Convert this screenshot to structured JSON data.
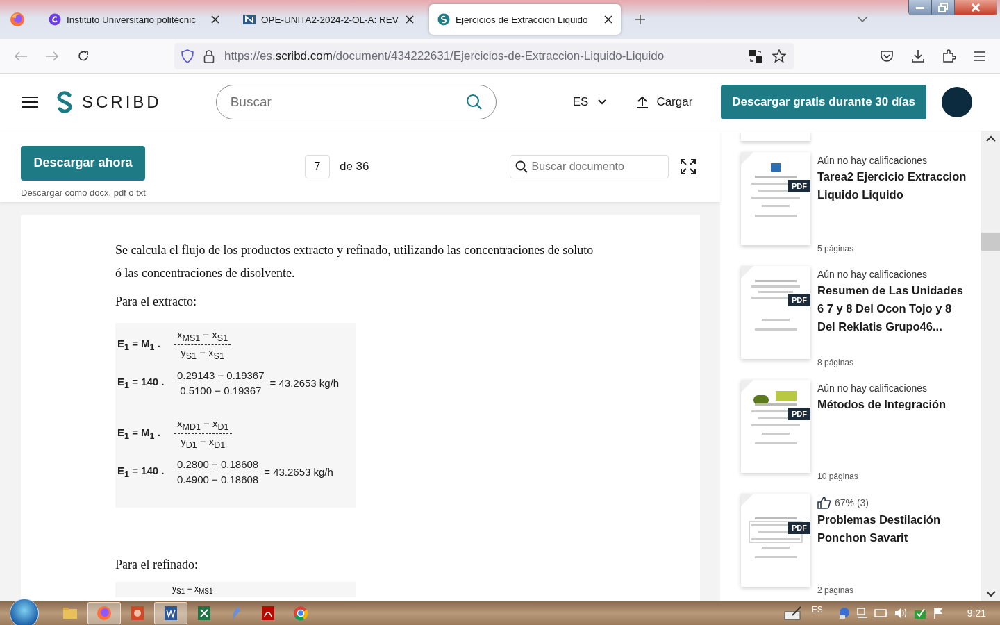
{
  "browser": {
    "tabs": [
      {
        "title": "Instituto Universitario politécnic",
        "kind": "c",
        "selected": false
      },
      {
        "title": "OPE-UNITA2-2024-2-OL-A: REV",
        "kind": "n",
        "selected": false
      },
      {
        "title": "Ejercicios de Extraccion Liquido",
        "kind": "s",
        "selected": true
      }
    ],
    "url": {
      "prefix": "https://es.",
      "host": "scribd.com",
      "path": "/document/434222631/Ejercicios-de-Extraccion-Liquido-Liquido"
    }
  },
  "header": {
    "logo": "SCRIBD",
    "search_placeholder": "Buscar",
    "language": "ES",
    "upload": "Cargar",
    "cta": "Descargar gratis durante 30 días"
  },
  "doc_toolbar": {
    "download": "Descargar ahora",
    "download_note": "Descargar como docx, pdf o txt",
    "page": "7",
    "page_total": "de 36",
    "search_placeholder": "Buscar documento"
  },
  "document": {
    "paragraphs": [
      "Se calcula el flujo de los productos extracto y refinado, utilizando las concentraciones de soluto ó las concentraciones de disolvente.",
      "Para el extracto:"
    ],
    "equations": [
      {
        "lhs": "E$_{1}$ = M$_{1}$ .",
        "num": "x$_{MS1}$ − x$_{S1}$",
        "den": "y$_{S1}$ − x$_{S1}$"
      },
      {
        "lhs": "E$_{1}$ = 140 .",
        "num": "0.29143 − 0.19367",
        "den": "0.5100 − 0.19367",
        "rhs": "= 43.2653 kg/h"
      },
      {
        "lhs": "E$_{1}$ = M$_{1}$ .",
        "num": "x$_{MD1}$ − x$_{D1}$",
        "den": "y$_{D1}$ − x$_{D1}$"
      },
      {
        "lhs": "E$_{1}$ = 140 .",
        "num": "0.2800 − 0.18608",
        "den": "0.4900 − 0.18608",
        "rhs": "= 43.2653 kg/h"
      }
    ],
    "after": "Para el refinado:",
    "next_equation_top": "y$_{S1}$ − x$_{MS1}$"
  },
  "sidebar": {
    "items": [
      {
        "likes": false,
        "rating": "Aún no hay calificaciones",
        "title": "Tarea2 Ejercicio Extraccion Liquido Liquido",
        "pages": "5 páginas",
        "badge": "PDF"
      },
      {
        "likes": false,
        "rating": "Aún no hay calificaciones",
        "title": "Resumen de Las Unidades 6 7 y 8 Del Ocon Tojo y 8 Del Reklatis Grupo46...",
        "pages": "8 páginas",
        "badge": "PDF"
      },
      {
        "likes": false,
        "rating": "Aún no hay calificaciones",
        "title": "Métodos de Integración",
        "pages": "10 páginas",
        "badge": "PDF"
      },
      {
        "likes": true,
        "rating": "67% (3)",
        "title": "Problemas Destilación Ponchon Savarit",
        "pages": "2 páginas",
        "badge": "PDF"
      }
    ]
  },
  "taskbar": {
    "language": "ES",
    "time": "9:21"
  }
}
